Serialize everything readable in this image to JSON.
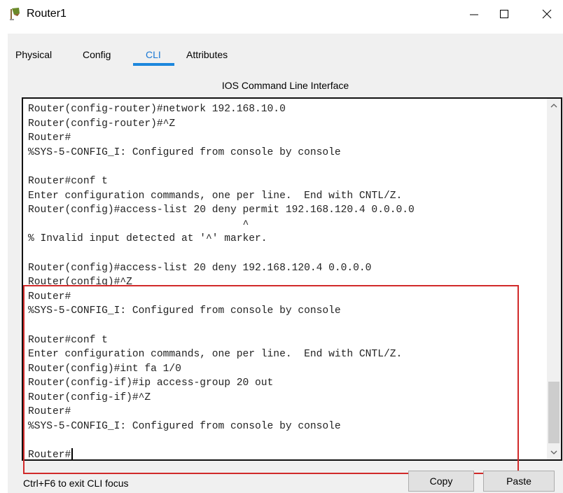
{
  "window": {
    "title": "Router1",
    "app_icon": "router-icon",
    "controls": {
      "minimize": "—",
      "maximize": "☐",
      "close": "✕"
    }
  },
  "tabs": [
    {
      "label": "Physical",
      "active": false
    },
    {
      "label": "Config",
      "active": false
    },
    {
      "label": "CLI",
      "active": true
    },
    {
      "label": "Attributes",
      "active": false
    }
  ],
  "cli": {
    "header": "IOS Command Line Interface",
    "lines": [
      "Router(config-router)#network 192.168.10.0",
      "Router(config-router)#^Z",
      "Router#",
      "%SYS-5-CONFIG_I: Configured from console by console",
      "",
      "Router#conf t",
      "Enter configuration commands, one per line.  End with CNTL/Z.",
      "Router(config)#access-list 20 deny permit 192.168.120.4 0.0.0.0",
      "                                   ^",
      "% Invalid input detected at '^' marker.",
      "",
      "Router(config)#access-list 20 deny 192.168.120.4 0.0.0.0",
      "Router(config)#^Z",
      "Router#",
      "%SYS-5-CONFIG_I: Configured from console by console",
      "",
      "Router#conf t",
      "Enter configuration commands, one per line.  End with CNTL/Z.",
      "Router(config)#int fa 1/0",
      "Router(config-if)#ip access-group 20 out",
      "Router(config-if)#^Z",
      "Router#",
      "%SYS-5-CONFIG_I: Configured from console by console",
      "",
      "Router#"
    ],
    "highlight_color": "#d12a2a"
  },
  "footer": {
    "hint": "Ctrl+F6 to exit CLI focus",
    "copy_label": "Copy",
    "paste_label": "Paste"
  },
  "colors": {
    "accent": "#1c87dd",
    "highlight": "#d12a2a"
  }
}
